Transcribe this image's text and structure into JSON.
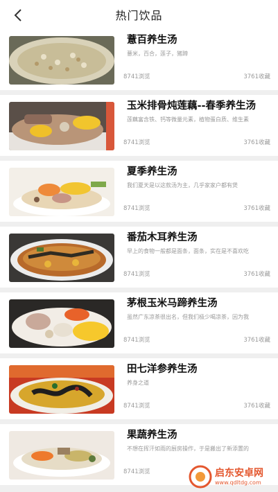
{
  "header": {
    "title": "热门饮品",
    "back_icon": "chevron-left-icon"
  },
  "items": [
    {
      "name": "薏百养生汤",
      "desc": "薏米，百合，莲子，猪蹄",
      "views": "8741浏览",
      "saves": "3761收藏"
    },
    {
      "name": "玉米排骨炖莲藕--春季养生汤",
      "desc": "莲藕富含铁、钙等微量元素，植物蛋白质、维生素",
      "views": "8741浏览",
      "saves": "3761收藏"
    },
    {
      "name": "夏季养生汤",
      "desc": "我们夏天是以这款汤为主，几乎家家户都有煲",
      "views": "8741浏览",
      "saves": "3761收藏"
    },
    {
      "name": "番茄木耳养生汤",
      "desc": "早上的食物一般都是面条，面条，实在是不喜欢吃",
      "views": "8741浏览",
      "saves": "3761收藏"
    },
    {
      "name": "茅根玉米马蹄养生汤",
      "desc": "虽然广东凉茶很出名，但我们极少喝凉茶，因为我",
      "views": "8741浏览",
      "saves": "3761收藏"
    },
    {
      "name": "田七洋参养生汤",
      "desc": "养身之道",
      "views": "8741浏览",
      "saves": "3761收藏"
    },
    {
      "name": "果蔬养生汤",
      "desc": "不想在挥汗如雨的厨房操作，于是搬出了新添置的",
      "views": "8741浏览",
      "saves": ""
    }
  ],
  "watermark": {
    "cn": "启东安卓网",
    "url": "www.qdltdg.com"
  },
  "colors": {
    "accent": "#e4572e",
    "text_primary": "#111111",
    "text_secondary": "#999999",
    "background": "#efefef"
  }
}
